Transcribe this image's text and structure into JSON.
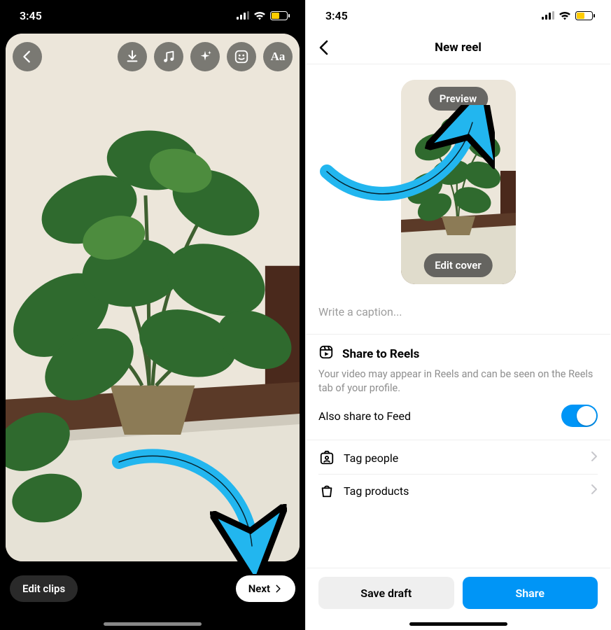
{
  "status": {
    "time": "3:45"
  },
  "editor": {
    "tools": {
      "back": "back-icon",
      "download": "download-icon",
      "music": "music-icon",
      "sparkle": "sparkle-icon",
      "sticker": "sticker-icon",
      "text": "Aa"
    },
    "edit_clips_label": "Edit clips",
    "next_label": "Next"
  },
  "newreel": {
    "title": "New reel",
    "preview_label": "Preview",
    "edit_cover_label": "Edit cover",
    "caption_placeholder": "Write a caption...",
    "share_to_reels": {
      "heading": "Share to Reels",
      "desc": "Your video may appear in Reels and can be seen on the Reels tab of your profile.",
      "also_feed_label": "Also share to Feed",
      "also_feed_on": true
    },
    "rows": {
      "tag_people": "Tag people",
      "tag_products": "Tag products"
    },
    "footer": {
      "save_draft": "Save draft",
      "share": "Share"
    }
  },
  "colors": {
    "accent": "#0095f6",
    "annotation": "#22b6ef"
  }
}
